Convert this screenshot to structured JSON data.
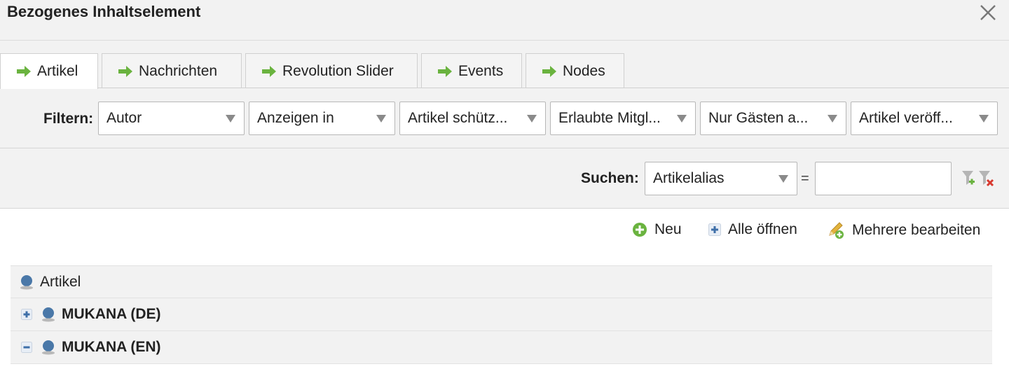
{
  "dialog": {
    "title": "Bezogenes Inhaltselement",
    "close_icon": "close-icon"
  },
  "tabs": [
    {
      "label": "Artikel",
      "active": true
    },
    {
      "label": "Nachrichten",
      "active": false
    },
    {
      "label": "Revolution Slider",
      "active": false
    },
    {
      "label": "Events",
      "active": false
    },
    {
      "label": "Nodes",
      "active": false
    }
  ],
  "filter": {
    "label": "Filtern:",
    "selects": [
      "Autor",
      "Anzeigen in",
      "Artikel schütz...",
      "Erlaubte Mitgl...",
      "Nur Gästen a...",
      "Artikel veröff..."
    ]
  },
  "search": {
    "label": "Suchen:",
    "field": "Artikelalias",
    "operator": "=",
    "value": ""
  },
  "actions": {
    "new": "Neu",
    "expand_all": "Alle öffnen",
    "multi_edit": "Mehrere bearbeiten"
  },
  "tree": {
    "root": "Artikel",
    "nodes": [
      {
        "label": "MUKANA (DE)",
        "state": "collapsed"
      },
      {
        "label": "MUKANA (EN)",
        "state": "expanded"
      }
    ]
  },
  "colors": {
    "accent_green": "#6ab33f",
    "node_blue": "#4a78a8",
    "remove_red": "#d83a2f"
  }
}
